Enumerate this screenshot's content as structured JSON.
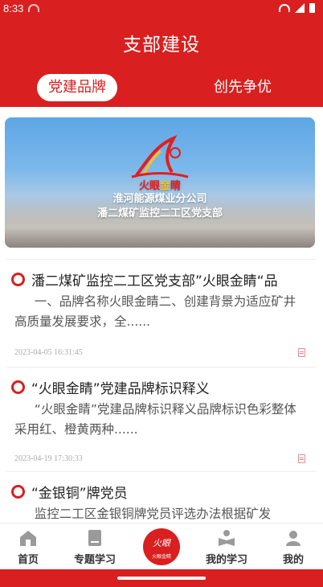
{
  "status": {
    "time": "8:33"
  },
  "header": {
    "title": "支部建设"
  },
  "tabs": [
    {
      "label": "党建品牌",
      "active": true
    },
    {
      "label": "创先争优",
      "active": false
    }
  ],
  "banner": {
    "line1_a": "火眼",
    "line1_b": "金",
    "line1_c": "睛",
    "line2": "淮河能源煤业分公司",
    "line3": "潘二煤矿监控二工区党支部"
  },
  "articles": [
    {
      "title": "潘二煤矿监控二工区党支部”火眼金睛“品",
      "summary": "一、品牌名称火眼金睛二、创建背景为适应矿井高质量发展要求，全......",
      "date": "2023-04-05 16:31:45"
    },
    {
      "title": "“火眼金睛”党建品牌标识释义",
      "summary": "“火眼金睛”党建品牌标识释义品牌标识色彩整体采用红、橙黄两种......",
      "date": "2023-04-19 17:30:33"
    },
    {
      "title": "“金银铜”牌党员",
      "summary": "监控二工区金银铜牌党员评选办法根据矿发",
      "date": ""
    }
  ],
  "nav": {
    "items": [
      {
        "label": "首页",
        "icon": "home-icon"
      },
      {
        "label": "专题学习",
        "icon": "book-icon"
      },
      {
        "label": "",
        "icon": "brand-logo"
      },
      {
        "label": "我的学习",
        "icon": "reading-icon"
      },
      {
        "label": "我的",
        "icon": "user-icon"
      }
    ],
    "center_text_1": "火眼",
    "center_text_2": "火眼金睛"
  },
  "colors": {
    "primary": "#d91f1f",
    "gold": "#f6c21a",
    "text": "#222222",
    "muted": "#aaaaaa"
  }
}
